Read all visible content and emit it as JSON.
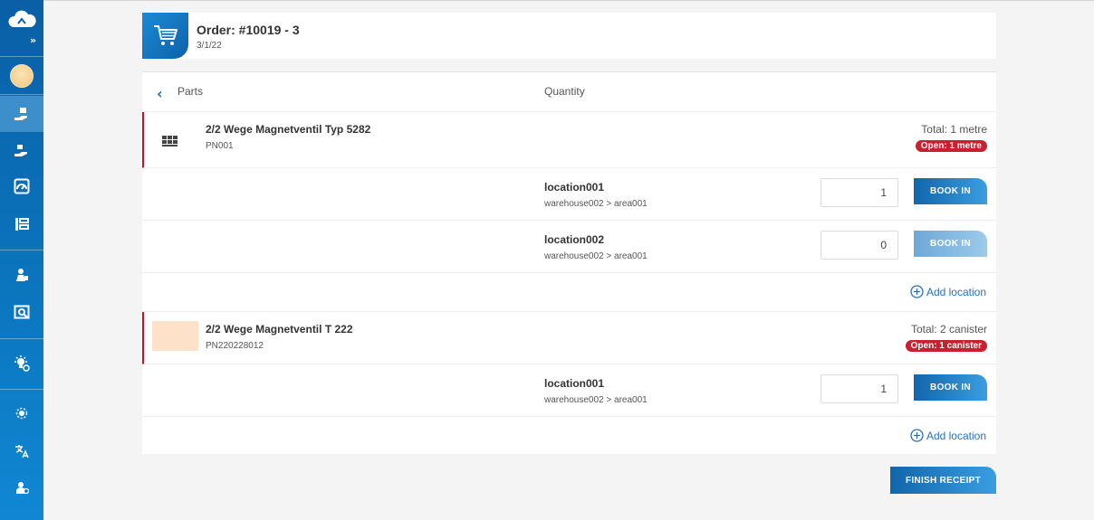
{
  "sidebar": {
    "expand_label": "»",
    "items": [
      {
        "icon": "avatar"
      },
      {
        "icon": "goods-receipt-icon",
        "active": true
      },
      {
        "icon": "goods-issue-icon"
      },
      {
        "icon": "dashboard-icon"
      },
      {
        "icon": "inventory-icon"
      },
      {
        "icon": "users-icon"
      },
      {
        "icon": "reports-icon"
      },
      {
        "icon": "settings-lightbulb-icon"
      },
      {
        "icon": "brightness-icon"
      },
      {
        "icon": "translate-icon"
      },
      {
        "icon": "user-info-icon"
      }
    ]
  },
  "order": {
    "title": "Order: #10019 - 3",
    "date": "3/1/22"
  },
  "columns": {
    "parts": "Parts",
    "quantity": "Quantity"
  },
  "parts": [
    {
      "name": "2/2 Wege Magnetventil Typ 5282",
      "pn": "PN001",
      "total": "Total: 1 metre",
      "open": "Open: 1 metre",
      "locations": [
        {
          "name": "location001",
          "path": "warehouse002 > area001",
          "qty": "1",
          "book_label": "BOOK IN"
        },
        {
          "name": "location002",
          "path": "warehouse002 > area001",
          "qty": "0",
          "book_label": "BOOK IN"
        }
      ],
      "add_location": "Add location"
    },
    {
      "name": "2/2 Wege Magnetventil T 222",
      "pn": "PN220228012",
      "total": "Total: 2 canister",
      "open": "Open: 1 canister",
      "locations": [
        {
          "name": "location001",
          "path": "warehouse002 > area001",
          "qty": "1",
          "book_label": "BOOK IN"
        }
      ],
      "add_location": "Add location"
    }
  ],
  "finish_label": "FINISH RECEIPT",
  "colors": {
    "primary": "#1265ab",
    "accent": "#3a9ee0",
    "danger": "#c8202f",
    "sidebar": "#0b77c0"
  }
}
